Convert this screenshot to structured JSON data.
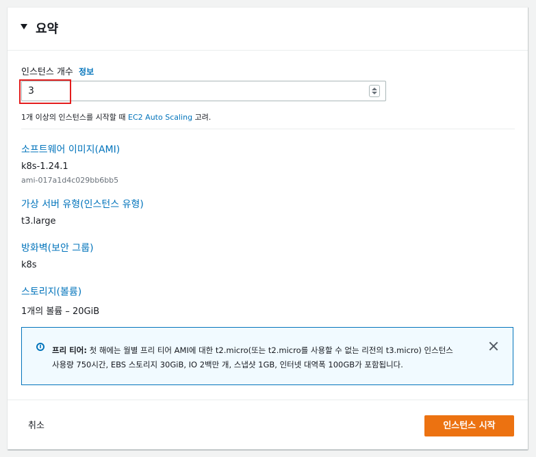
{
  "header": {
    "title": "요약"
  },
  "instance_count": {
    "label": "인스턴스 개수",
    "info": "정보",
    "value": "3",
    "hint_prefix": "1개 이상의 인스턴스를 시작할 때 ",
    "hint_link": "EC2 Auto Scaling",
    "hint_suffix": " 고려."
  },
  "ami": {
    "title": "소프트웨어 이미지(AMI)",
    "name": "k8s-1.24.1",
    "id": "ami-017a1d4c029bb6bb5"
  },
  "instance_type": {
    "title": "가상 서버 유형(인스턴스 유형)",
    "value": "t3.large"
  },
  "firewall": {
    "title": "방화벽(보안 그룹)",
    "value": "k8s"
  },
  "storage": {
    "title": "스토리지(볼륨)",
    "value": "1개의 볼륨 – 20GiB"
  },
  "alert": {
    "bold": "프리 티어:",
    "line1": " 첫 해에는 월별 프리 티어 AMI에 대한 t2.micro(또는 t2.micro를 사용할 수 없는 리전의 t3.micro) 인스턴스",
    "line2": "사용량 750시간, EBS 스토리지 30GiB, IO 2백만 개, 스냅샷 1GB, 인터넷 대역폭 100GB가 포함됩니다."
  },
  "footer": {
    "cancel": "취소",
    "launch": "인스턴스 시작"
  }
}
